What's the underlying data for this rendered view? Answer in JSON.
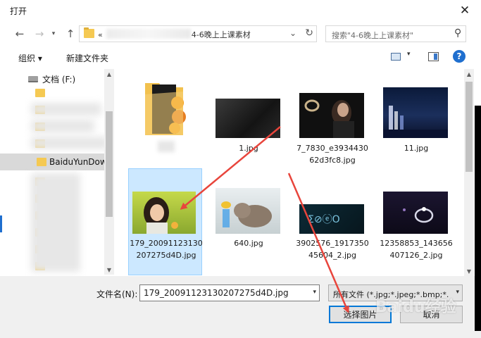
{
  "window": {
    "title": "打开"
  },
  "address": {
    "prefix": "«",
    "path_visible": "4-6晚上上课素材"
  },
  "search": {
    "placeholder": "搜索\"4-6晚上上课素材\""
  },
  "toolbar": {
    "organize": "组织 ▾",
    "new_folder": "新建文件夹",
    "help": "?"
  },
  "nav": {
    "drive_label": "文档 (F:)",
    "selected_folder": "BaiduYunDow"
  },
  "files": [
    {
      "name": "",
      "kind": "folder"
    },
    {
      "name": "1.jpg",
      "kind": "image"
    },
    {
      "name": "7_7830_e393443062d3fc8.jpg",
      "kind": "image"
    },
    {
      "name": "11.jpg",
      "kind": "image"
    },
    {
      "name": "179_2009112313020727 5d4D.jpg",
      "kind": "image",
      "selected": true
    },
    {
      "name": "640.jpg",
      "kind": "image"
    },
    {
      "name": "3902576_191735045604_2.jpg",
      "kind": "image"
    },
    {
      "name": "12358853_143656407126_2.jpg",
      "kind": "image"
    }
  ],
  "file_labels": {
    "f1": "1.jpg",
    "f2": "7_7830_e393443062d3fc8.jpg",
    "f3": "11.jpg",
    "f4": "179_20091123130207275d4D.jpg",
    "f5": "640.jpg",
    "f6": "3902576_191735045604_2.jpg",
    "f7": "12358853_143656407126_2.jpg"
  },
  "filename": {
    "label": "文件名(N):",
    "value": "179_20091123130207275d4D.jpg"
  },
  "filetype": {
    "value": "所有文件 (*.jpg;*.jpeg;*.bmp;*."
  },
  "buttons": {
    "open": "选择图片",
    "cancel": "取消"
  },
  "watermark": "Baidu经验",
  "colors": {
    "accent": "#0078d7",
    "selection": "#cce8ff",
    "arrow": "#e8453c"
  }
}
